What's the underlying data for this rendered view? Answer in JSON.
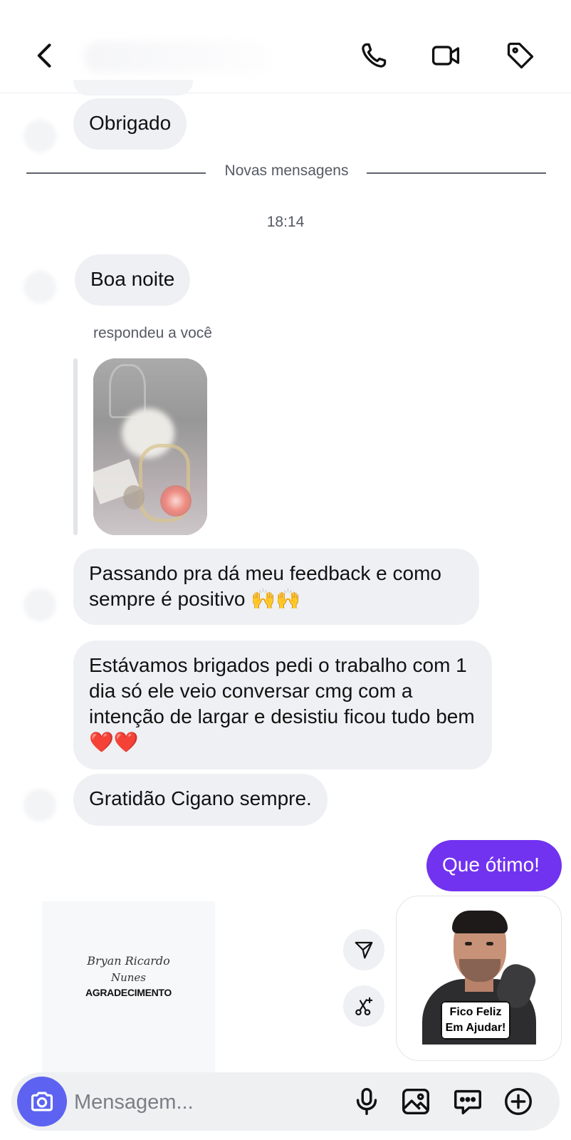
{
  "conversation": {
    "divider_label": "Novas mensagens",
    "timestamp": "18:14",
    "reply_label": "respondeu a você",
    "incoming": [
      {
        "text": "Obrigado"
      },
      {
        "text": "Boa noite"
      },
      {
        "text": "Passando pra dá meu feedback e como sempre é positivo 🙌🙌"
      },
      {
        "text": "Estávamos brigados pedi o trabalho com 1 dia só ele veio conversar cmg com a intenção de largar e desistiu ficou tudo bem ❤️❤️"
      },
      {
        "text": "Gratidão Cigano sempre."
      }
    ],
    "outgoing": [
      {
        "text": "Que ótimo!"
      }
    ],
    "gift_card": {
      "signature_line1": "Bryan Ricardo",
      "signature_line2": "Nunes",
      "title": "AGRADECIMENTO"
    },
    "sticker": {
      "caption_line1": "Fico Feliz",
      "caption_line2": "Em Ajudar!"
    }
  },
  "composer": {
    "placeholder": "Mensagem..."
  },
  "icons": {
    "header": [
      "back-icon",
      "phone-icon",
      "video-icon",
      "tag-icon"
    ],
    "composer": [
      "camera-icon",
      "microphone-icon",
      "gallery-icon",
      "sticker-message-icon",
      "plus-icon"
    ],
    "actions": [
      "send-paper-plane-icon",
      "scissors-sparkle-icon"
    ]
  },
  "colors": {
    "accent": "#7133f0",
    "camera_button": "#5d63f0",
    "bubble_incoming": "#eef0f3"
  }
}
